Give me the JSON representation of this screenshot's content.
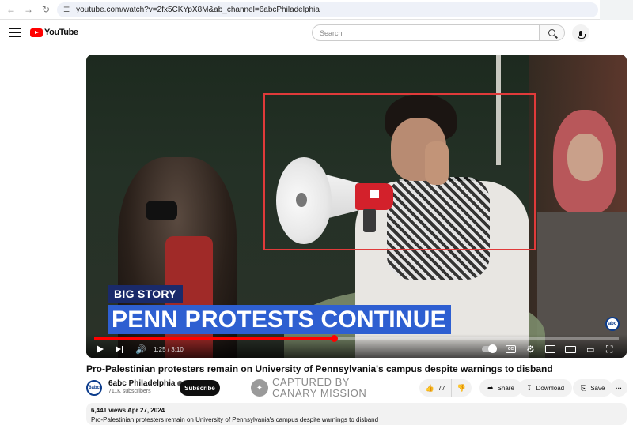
{
  "browser": {
    "url": "youtube.com/watch?v=2fx5CKYpX8M&ab_channel=6abcPhiladelphia"
  },
  "masthead": {
    "logo_text": "YouTube",
    "search_placeholder": "Search"
  },
  "player": {
    "tag": "BIG STORY",
    "headline": "PENN PROTESTS CONTINUE",
    "channel_bug": "abc",
    "time": "1:25 / 3:10",
    "progress_fraction": 0.457
  },
  "video": {
    "title": "Pro-Palestinian protesters remain on University of Pennsylvania's campus despite warnings to disband"
  },
  "owner": {
    "avatar_text": "6abc",
    "channel_name": "6abc Philadelphia",
    "subscribers": "711K subscribers",
    "subscribe_label": "Subscribe"
  },
  "watermark": {
    "line1": "CAPTURED BY",
    "line2": "CANARY MISSION"
  },
  "actions": {
    "likes": "77",
    "share": "Share",
    "download": "Download",
    "save": "Save",
    "more": "···"
  },
  "description": {
    "meta": "6,441 views  Apr 27, 2024",
    "text": "Pro-Palestinian protesters remain on University of Pennsylvania's campus despite warnings to disband"
  }
}
